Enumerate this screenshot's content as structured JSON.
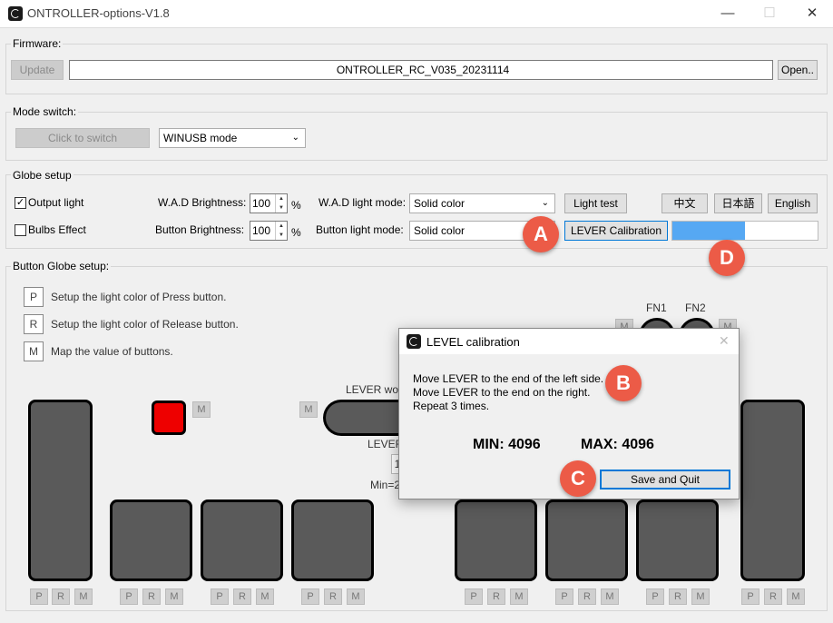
{
  "window": {
    "title": "ONTROLLER-options-V1.8",
    "minimize": "—",
    "maximize": "☐",
    "close": "✕"
  },
  "firmware": {
    "label": "Firmware:",
    "update": "Update",
    "version": "ONTROLLER_RC_V035_20231114",
    "open": "Open.."
  },
  "mode_switch": {
    "label": "Mode switch:",
    "switch": "Click to switch",
    "mode": "WINUSB mode"
  },
  "globe_setup": {
    "label": "Globe setup",
    "output_light": "Output light",
    "bulbs_effect": "Bulbs Effect",
    "wad_brightness_label": "W.A.D Brightness:",
    "wad_brightness": "100",
    "button_brightness_label": "Button Brightness:",
    "button_brightness": "100",
    "percent": "%",
    "wad_mode_label": "W.A.D light mode:",
    "wad_mode": "Solid color",
    "button_mode_label": "Button light mode:",
    "button_mode": "Solid color",
    "light_test": "Light test",
    "lever_calibration": "LEVER Calibration",
    "lang_zh": "中文",
    "lang_ja": "日本語",
    "lang_en": "English",
    "progress": 0.5
  },
  "button_globe": {
    "label": "Button Globe setup:",
    "legend": [
      {
        "key": "P",
        "text": "Setup the light color of Press button."
      },
      {
        "key": "R",
        "text": "Setup the light color of Release button."
      },
      {
        "key": "M",
        "text": "Map the value of buttons."
      }
    ],
    "fn1": "FN1",
    "fn2": "FN2",
    "lever_wo": "LEVER wo",
    "lever": "LEVER",
    "one": "1",
    "min_eq": "Min=2",
    "m": "M",
    "p": "P",
    "r": "R"
  },
  "dialog": {
    "title": "LEVEL calibration",
    "line1": "Move LEVER to the end of the left side.",
    "line2": "Move LEVER to the end on the right.",
    "line3": "Repeat 3 times.",
    "min": "MIN: 4096",
    "max": "MAX: 4096",
    "save": "Save and Quit",
    "close": "✕"
  },
  "annotations": {
    "a": "A",
    "b": "B",
    "c": "C",
    "d": "D"
  },
  "colors": {
    "accent": "#ec5b47",
    "progress": "#56a8f3",
    "red_button": "#ee0000"
  }
}
